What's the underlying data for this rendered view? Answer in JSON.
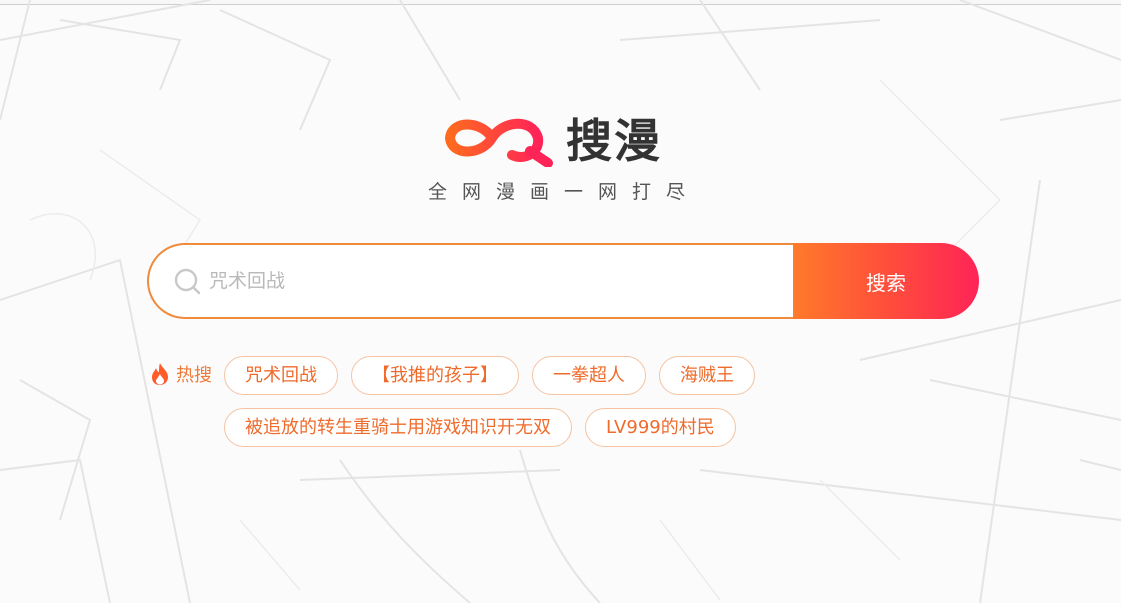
{
  "brand": {
    "name": "搜漫",
    "slogan": "全网漫画一网打尽",
    "logo_icon": "infinity-search-logo",
    "colors": {
      "orange": "#ff6a1f",
      "red": "#ff2457",
      "text": "#333333"
    }
  },
  "search": {
    "placeholder": "咒术回战",
    "value": "",
    "button_label": "搜索",
    "icon": "search-icon"
  },
  "hot": {
    "label": "热搜",
    "icon": "fire-icon",
    "tags": [
      "咒术回战",
      "【我推的孩子】",
      "一拳超人",
      "海贼王",
      "被追放的转生重骑士用游戏知识开无双",
      "LV999的村民"
    ]
  }
}
